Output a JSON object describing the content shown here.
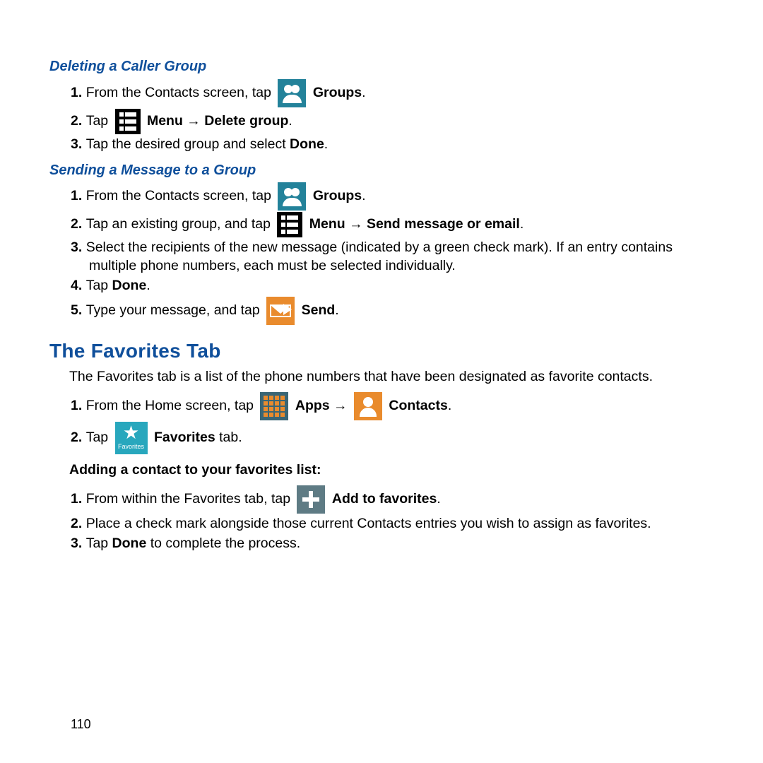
{
  "page_number": "110",
  "section1": {
    "heading": "Deleting a Caller Group",
    "steps": [
      {
        "pre": "From the Contacts screen, tap ",
        "post_bold": "Groups",
        "post_tail": "."
      },
      {
        "pre": "Tap ",
        "post_bold": "Menu → Delete group",
        "post_tail": "."
      },
      {
        "plain_pre": "Tap the desired group and select ",
        "plain_bold": "Done",
        "plain_tail": "."
      }
    ]
  },
  "section2": {
    "heading": "Sending a Message to a Group",
    "step1": {
      "pre": "From the Contacts screen, tap ",
      "post_bold": "Groups",
      "post_tail": "."
    },
    "step2": {
      "pre": "Tap an existing group, and tap ",
      "post_bold": "Menu → Send message or email",
      "post_tail": "."
    },
    "step3": "Select the recipients of the new message (indicated by a green check mark). If an entry contains multiple phone numbers, each must be selected individually.",
    "step4": {
      "pre": "Tap ",
      "bold": "Done",
      "tail": "."
    },
    "step5": {
      "pre": "Type your message, and tap ",
      "post_bold": "Send",
      "post_tail": "."
    }
  },
  "favorites": {
    "heading": "The Favorites Tab",
    "intro": "The Favorites tab is a list of the phone numbers that have been designated as favorite contacts.",
    "step1": {
      "pre": "From the Home screen, tap ",
      "mid_bold": "Apps → ",
      "post_bold": "Contacts",
      "post_tail": "."
    },
    "step2": {
      "pre": "Tap ",
      "post_bold": "Favorites",
      "post_plain": " tab."
    },
    "sublabel": "Adding a contact to your favorites list:",
    "fstep1": {
      "pre": "From within the Favorites tab, tap ",
      "post_bold": "Add to favorites",
      "post_tail": "."
    },
    "fstep2": "Place a check mark alongside those current Contacts entries you wish to assign as favorites.",
    "fstep3": {
      "pre": "Tap ",
      "bold": "Done",
      "tail": " to complete the process."
    }
  },
  "icon_labels": {
    "favorites_caption": "Favorites"
  }
}
